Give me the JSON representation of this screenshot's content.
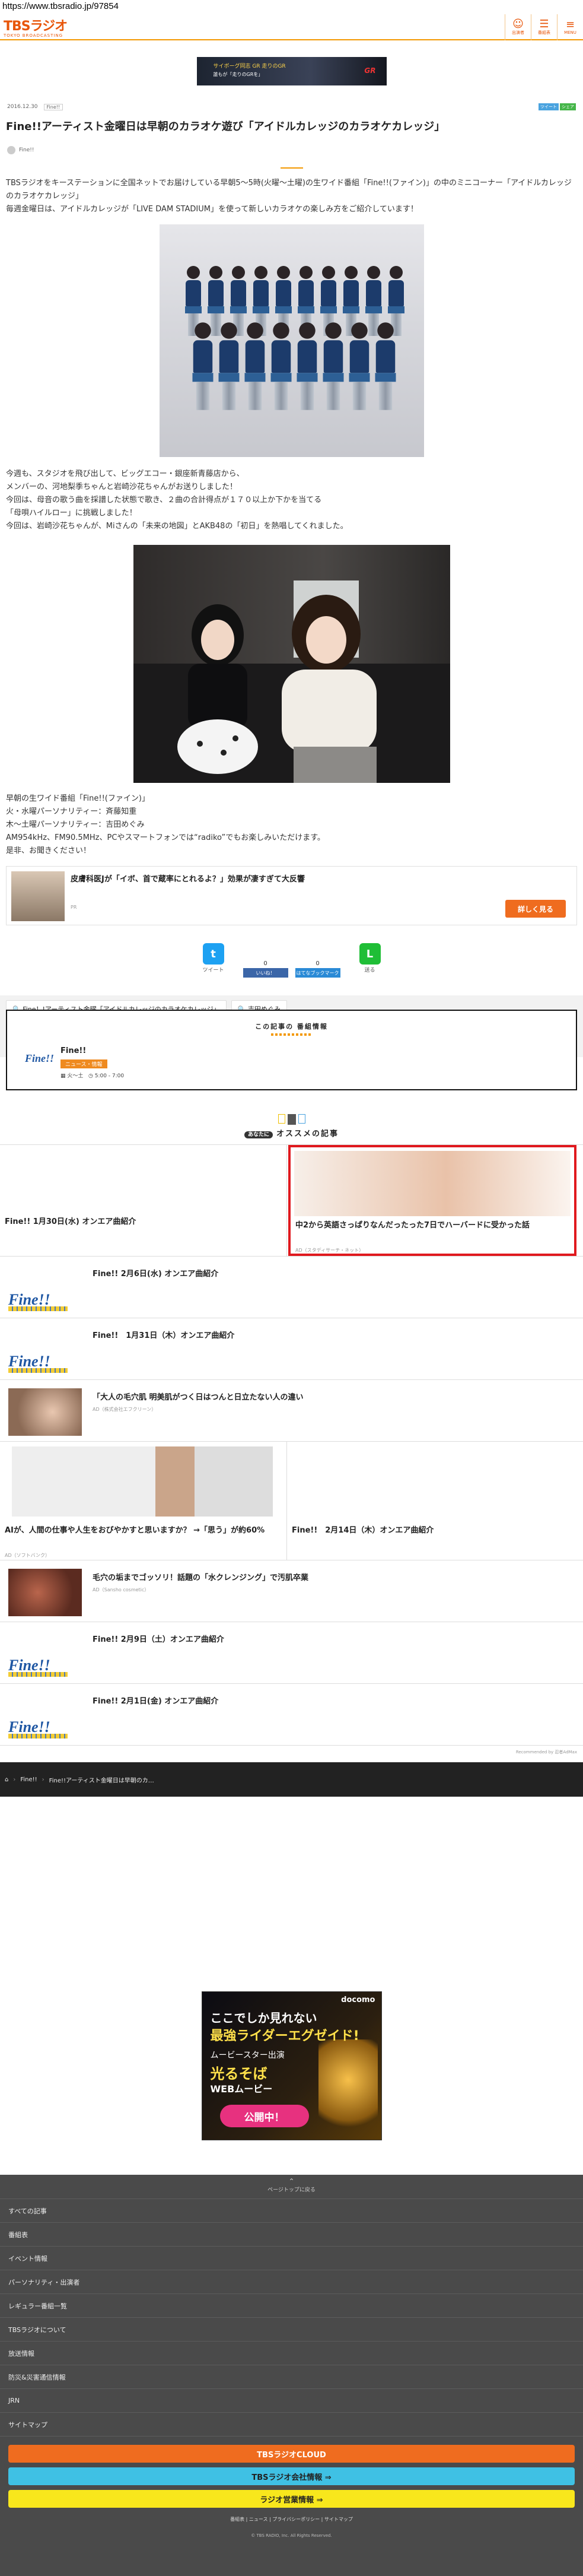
{
  "browser": {
    "url": "https://www.tbsradio.jp/97854"
  },
  "header": {
    "logo": "TBSラジオ",
    "logo_sub": "TOKYO BROADCASTING",
    "icons": [
      {
        "label": "出演者",
        "glyph": "☺"
      },
      {
        "label": "番組表",
        "glyph": "☰"
      },
      {
        "label": "MENU",
        "glyph": "≡"
      }
    ]
  },
  "top_ad": {
    "line1": "サイボーグ同志  GR 走りのGR",
    "line2": "誰もが「走りのGRを」",
    "brand": "GR"
  },
  "article": {
    "date": "2016.12.30",
    "category": "Fine!!",
    "share_counts": [
      "ツイート",
      "シェア"
    ],
    "title": "Fine!!アーティスト金曜日は早朝のカラオケ遊び「アイドルカレッジのカラオケカレッジ」",
    "author": "Fine!!",
    "lead": "TBSラジオをキーステーションに全国ネットでお届けしている早朝5〜5時(火曜〜土曜)の生ワイド番組「Fine!!(ファイン)」の中のミニコーナー「アイドルカレッジのカラオケカレッジ」\n毎週金曜日は、アイドルカレッジが「LIVE DAM STADIUM」を使って新しいカラオケの楽しみ方をご紹介しています！",
    "body": "今週も、スタジオを飛び出して、ビッグエコー・銀座新青藤店から、\nメンバーの、河地梨季ちゃんと岩崎沙花ちゃんがお送りしました！\n今回は、母音の歌う曲を採譜した状態で歌き、２曲の合計得点が１７０以上か下かを当てる\n「母唄ハイルロー」に挑戦しました！\n今回は、岩崎沙花ちゃんが、Miさんの「未来の地図」とAKB48の「初日」を熱唱してくれました。",
    "footer_info": "早朝の生ワイド番組「Fine!!(ファイン)」\n火・水曜パーソナリティー：斉藤知重\n木〜土曜パーソナリティー：吉田めぐみ\nAM954kHz、FM90.5MHz、PCやスマートフォンでは“radiko”でもお楽しみいただけます。\n是非、お聞きください！"
  },
  "pr_card": {
    "title": "皮膚科医Jが「イボ、首で蔵率にとれるよ？」効果が凄すぎて大反響",
    "pr_label": "PR",
    "button": "詳しく見る"
  },
  "share": [
    {
      "label": "ツイート",
      "icon": "twitter-icon",
      "count": "",
      "color": "#1da1f2",
      "glyph": "t"
    },
    {
      "label": "いいね！",
      "icon": "facebook-icon",
      "count": "0",
      "color": "#3b66a8",
      "glyph": "f"
    },
    {
      "label": "はてなブックマーク",
      "icon": "hatena-icon",
      "count": "0",
      "color": "#2a8ad6",
      "glyph": "B!"
    },
    {
      "label": "送る",
      "icon": "line-icon",
      "count": "",
      "color": "#1fbe36",
      "glyph": "L"
    }
  ],
  "tags": [
    "Fine！!アーティスト金曜「アイドルカレッジのカラオケカレッジ」",
    "吉田めぐみ"
  ],
  "bangumi": {
    "heading": "この記事の 番組情報",
    "name": "Fine!!",
    "badge": "ニュース・情報",
    "schedule": "火〜土",
    "time": "5:00 - 7:00"
  },
  "recommend": {
    "heading": "オススメの記事",
    "badge": "あなたに",
    "items": [
      {
        "type": "pair",
        "left": {
          "title": "Fine!! 1月30日(水) オンエア曲紹介",
          "adsrc": ""
        },
        "right": {
          "title": "中2から英語さっぱりなんだったった7日でハーバードに受かった話",
          "adsrc": "AD（スタディサーチ・ネット）"
        }
      },
      {
        "type": "row",
        "title": "Fine!! 2月6日(水) オンエア曲紹介",
        "adsrc": "",
        "thumb": "logo"
      },
      {
        "type": "row",
        "title": "Fine!!　1月31日（木）オンエア曲紹介",
        "adsrc": "",
        "thumb": "logo"
      },
      {
        "type": "row",
        "title": "「大人の毛穴肌 明美肌がつく日はつんと日立たない人の違い",
        "adsrc": "AD（株式会社エフクリーン）",
        "thumb": "face"
      },
      {
        "type": "pair",
        "left": {
          "title": "AIが、人間の仕事や人生をおびやかすと思いますか？ →「思う」が約60%",
          "adsrc": "AD（ソフトバンク）"
        },
        "right": {
          "title": "Fine!!　2月14日（木）オンエア曲紹介",
          "adsrc": ""
        }
      },
      {
        "type": "row",
        "title": "毛穴の垢までゴッソリ！話題の「水クレンジング」で汚肌卒業",
        "adsrc": "AD（Sansho cosmetic）",
        "thumb": "mud"
      },
      {
        "type": "row",
        "title": "Fine!! 2月9日（土）オンエア曲紹介",
        "adsrc": "",
        "thumb": "logo"
      },
      {
        "type": "row",
        "title": "Fine!! 2月1日(金) オンエア曲紹介",
        "adsrc": "",
        "thumb": "logo"
      }
    ],
    "powered": "Recommended by 忍者AdMax"
  },
  "breadcrumb": [
    "Fine!!",
    "Fine!!アーティスト金曜日は早朝のカ…"
  ],
  "bottom_ad": {
    "brand": "docomo",
    "l1": "ここでしか見れない",
    "l2": "最強ライダーエグゼイド!",
    "l3": "ムービースター出演",
    "l4": "光るそば",
    "l5": "WEBムービー",
    "cta": "公開中！"
  },
  "footer": {
    "pagetop": "ページトップに戻る",
    "menu": [
      "すべての記事",
      "番組表",
      "イベント情報",
      "パーソナリティ・出演者",
      "レギュラー番組一覧",
      "TBSラジオについて",
      "放送情報",
      "防災&災害通信情報",
      "JRN",
      "サイトマップ"
    ],
    "buttons": [
      {
        "label": "TBSラジオCLOUD",
        "color": "#ef6c1f",
        "text_color": "#fff"
      },
      {
        "label": "TBSラジオ会社情報 ⇒",
        "color": "#3fc1e4",
        "text_color": "#222"
      },
      {
        "label": "ラジオ営業情報 ⇒",
        "color": "#f8e71c",
        "text_color": "#222"
      }
    ],
    "links": "番組表 | ニュース | プライバシーポリシー | サイトマップ",
    "copyright": "© TBS RADIO, Inc. All Rights Reserved."
  }
}
